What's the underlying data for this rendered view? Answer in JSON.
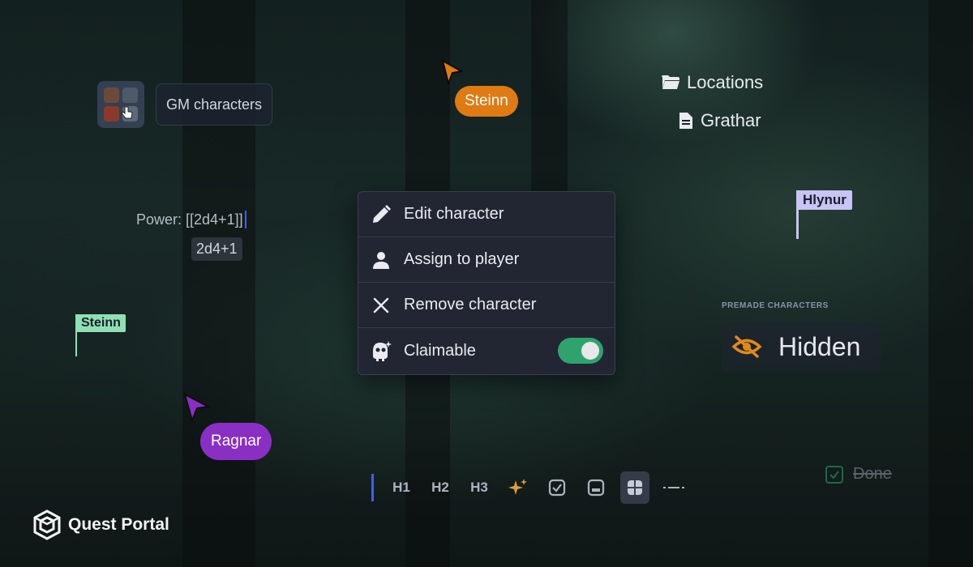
{
  "gm": {
    "label": "GM characters",
    "avatar_icon": "character-portraits-icon"
  },
  "cursors": {
    "top": {
      "name": "Steinn",
      "color": "#e07a12"
    },
    "bottom": {
      "name": "Ragnar",
      "color": "#8a2fc4"
    }
  },
  "flags": {
    "left": {
      "name": "Steinn",
      "color": "#8fe0b4"
    },
    "right": {
      "name": "Hlynur",
      "color": "#c8c4f5"
    }
  },
  "tree": {
    "folder": {
      "label": "Locations",
      "icon": "folder-icon"
    },
    "file": {
      "label": "Grathar",
      "icon": "document-icon"
    }
  },
  "editor": {
    "power_text": "Power: [[2d4+1]]",
    "roll_chip": "2d4+1"
  },
  "menu": {
    "items": [
      {
        "label": "Edit character",
        "icon": "pencil-icon"
      },
      {
        "label": "Assign to player",
        "icon": "user-icon"
      },
      {
        "label": "Remove character",
        "icon": "close-icon"
      },
      {
        "label": "Claimable",
        "icon": "claim-icon",
        "toggle_on": true
      }
    ]
  },
  "premade": {
    "label": "PREMADE CHARACTERS",
    "state": "Hidden",
    "icon": "eye-off-icon",
    "accent": "#e08a1a"
  },
  "toolbar": {
    "buttons": [
      {
        "label": "H1"
      },
      {
        "label": "H2"
      },
      {
        "label": "H3"
      },
      {
        "icon": "sparkles-icon"
      },
      {
        "icon": "checkbox-icon"
      },
      {
        "icon": "image-icon"
      },
      {
        "icon": "grid-icon",
        "active": true
      },
      {
        "icon": "divider-icon"
      }
    ]
  },
  "done": {
    "label": "Done",
    "checked": true
  },
  "brand": {
    "name": "Quest Portal"
  }
}
